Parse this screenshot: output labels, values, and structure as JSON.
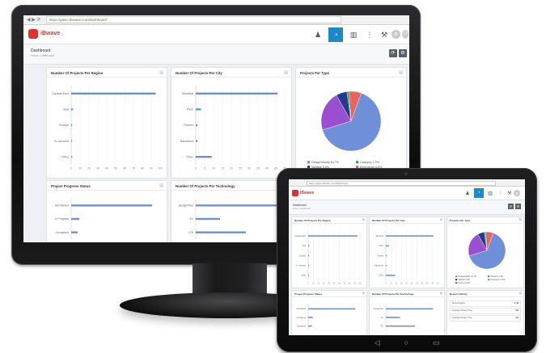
{
  "app": {
    "url": "https://gitsio.ibwave.com/dashboard",
    "logo_text": "iBwave"
  },
  "toolbar": {
    "icons": [
      "users-icon",
      "dashboard-gauge-icon",
      "stats-icon",
      "tree-icon",
      "wrench-icon",
      "settings-icon",
      "power-icon"
    ]
  },
  "header": {
    "title": "Dashboard",
    "breadcrumb": "Home / Dashboard"
  },
  "panels": {
    "projects_per_region": {
      "title": "Number Of Projects Per Region"
    },
    "projects_per_city": {
      "title": "Number Of Projects Per City"
    },
    "projects_per_type": {
      "title": "Projects Per Type"
    },
    "project_progress_status": {
      "title": "Project Progress Status"
    },
    "projects_per_technology": {
      "title": "Number Of Projects Per Technology"
    },
    "recent_activity": {
      "title": "Recent Activity"
    }
  },
  "chart_data": [
    {
      "type": "bar",
      "orientation": "horizontal",
      "panel": "projects_per_region",
      "categories": [
        "Canada-East",
        "Asia",
        "Europe",
        "N. America",
        "Other"
      ],
      "values": [
        95,
        2,
        1,
        1,
        1
      ],
      "xlim": [
        0,
        100
      ],
      "xticks": [
        "0",
        "10",
        "20",
        "30",
        "40",
        "50",
        "60",
        "70",
        "80",
        "90",
        "100"
      ],
      "color": "#6f8fd8"
    },
    {
      "type": "bar",
      "orientation": "horizontal",
      "panel": "projects_per_city",
      "categories": [
        "Montreal",
        "Paris",
        "Toronto",
        "Barcelona",
        "Other"
      ],
      "values": [
        46,
        3,
        1,
        1,
        9
      ],
      "xlim": [
        0,
        50
      ],
      "xticks": [
        "0",
        "5",
        "10",
        "15",
        "20",
        "25",
        "30",
        "35",
        "40",
        "45",
        "50"
      ],
      "color": "#6f8fd8"
    },
    {
      "type": "pie",
      "panel": "projects_per_type",
      "slices": [
        {
          "label": "Design/Modify",
          "value": 64.7,
          "color": "#6f8fd8"
        },
        {
          "label": "Survey",
          "value": 21.6,
          "color": "#9a4fd0"
        },
        {
          "label": "Validate",
          "value": 5.9,
          "color": "#243a8c"
        },
        {
          "label": "Category",
          "value": 1.2,
          "color": "#2fa84f"
        },
        {
          "label": "Emergency",
          "value": 6.6,
          "color": "#e8665a"
        }
      ],
      "legend": [
        "Design/Modify 64.7%",
        "Category 1.2%",
        "Validate 5.9%",
        "Emergency 6.6%",
        "Survey 21.6%"
      ]
    },
    {
      "type": "bar",
      "orientation": "horizontal",
      "panel": "project_progress_status",
      "categories": [
        "Not Started",
        "In Progress",
        "Completed"
      ],
      "values": [
        100,
        10,
        8
      ],
      "xlim": [
        0,
        110
      ],
      "color": "#6f8fd8"
    },
    {
      "type": "bar",
      "orientation": "horizontal",
      "panel": "projects_per_technology",
      "categories": [
        "Design/Plan",
        "4G",
        "LTE"
      ],
      "values": [
        100,
        30,
        62
      ],
      "xlim": [
        0,
        110
      ],
      "color": "#6f8fd8"
    }
  ],
  "recent_activity": {
    "rows": [
      {
        "label": "Most Projects",
        "value": "1,45"
      },
      {
        "label": "Average Survey Time",
        "value": "3.8"
      },
      {
        "label": "Average Design Time",
        "value": "4.2"
      }
    ]
  },
  "tablet_nav": [
    "◁",
    "○",
    "▭"
  ]
}
